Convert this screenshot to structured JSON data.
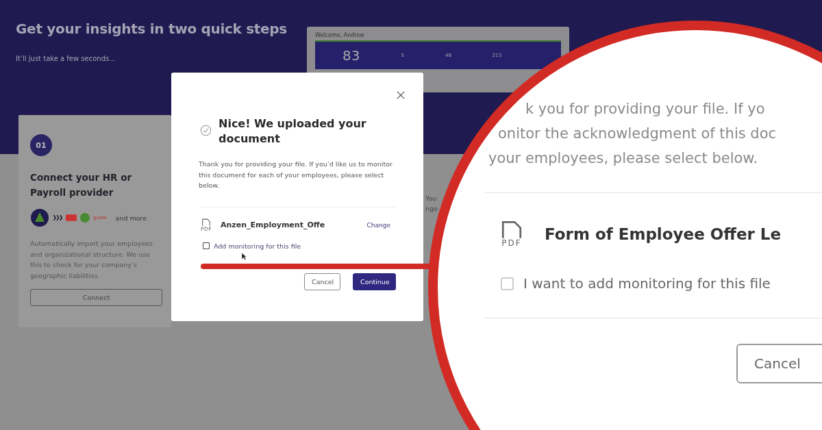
{
  "page": {
    "title": "Get your insights in two quick steps",
    "subtitle": "It’ll just take a few seconds..."
  },
  "dashboard_preview": {
    "greeting": "Welcome, Andrew",
    "score": "83",
    "stats": [
      "5",
      "48",
      "213"
    ]
  },
  "step_card": {
    "number": "01",
    "title": "Connect your HR or Payroll provider",
    "logo_text": "gusto",
    "integrations_more": "and more",
    "description": "Automatically import your employees and organizational structure. We use this to check for your company’s geographic liabilities.",
    "button": "Connect"
  },
  "second_card": {
    "lines": [
      "You",
      "ngo"
    ]
  },
  "modal": {
    "title": "Nice! We uploaded your document",
    "message": "Thank you for providing your file. If you’d like us to monitor this document for each of your employees, please select below.",
    "file": {
      "type": "PDF",
      "name": "Anzen_Employment_Offe",
      "action": "Change"
    },
    "monitoring": {
      "label": "Add monitoring for this file",
      "checked": false
    },
    "buttons": [
      {
        "label": "Cancel",
        "kind": "secondary"
      },
      {
        "label": "Continue",
        "kind": "primary"
      }
    ]
  },
  "magnifier": {
    "message_lines": [
      "k you for providing your file. If yo",
      "onitor the acknowledgment of this doc",
      "your employees, please select below."
    ],
    "file": {
      "type": "PDF",
      "name": "Form of Employee Offer Le"
    },
    "monitoring": {
      "label": "I want to add monitoring for this file",
      "checked": false
    },
    "button": "Cancel"
  }
}
